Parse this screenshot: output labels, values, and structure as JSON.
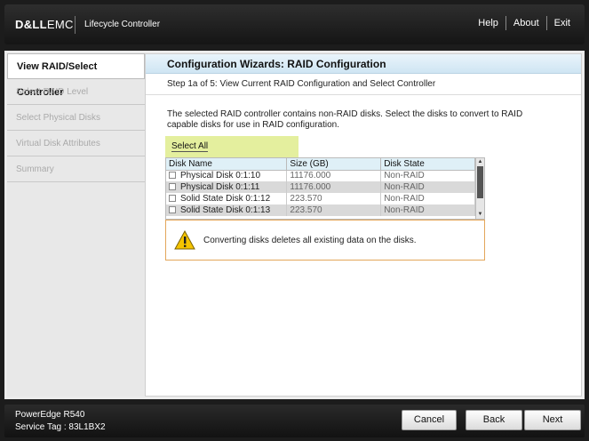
{
  "header": {
    "logo_dell": "D&LL",
    "logo_emc": "EMC",
    "product": "Lifecycle Controller",
    "nav": {
      "help": "Help",
      "about": "About",
      "exit": "Exit"
    }
  },
  "sidebar": {
    "steps": [
      {
        "label": "View RAID/Select Controller"
      },
      {
        "label": "Select RAID Level"
      },
      {
        "label": "Select Physical Disks"
      },
      {
        "label": "Virtual Disk Attributes"
      },
      {
        "label": "Summary"
      }
    ]
  },
  "main": {
    "title": "Configuration Wizards: RAID Configuration",
    "step_text": "Step 1a of 5: View Current RAID Configuration and Select Controller",
    "description": "The selected RAID controller contains non-RAID disks. Select the disks to convert to RAID capable disks for use in RAID configuration.",
    "select_all": "Select All",
    "table": {
      "headers": [
        "Disk Name",
        "Size (GB)",
        "Disk State"
      ],
      "rows": [
        {
          "name": "Physical Disk 0:1:10",
          "size": "11176.000",
          "state": "Non-RAID"
        },
        {
          "name": "Physical Disk 0:1:11",
          "size": "11176.000",
          "state": "Non-RAID"
        },
        {
          "name": "Solid State Disk 0:1:12",
          "size": "223.570",
          "state": "Non-RAID"
        },
        {
          "name": "Solid State Disk 0:1:13",
          "size": "223.570",
          "state": "Non-RAID"
        }
      ]
    },
    "warning": "Converting disks deletes all existing data on the disks.",
    "colors": {
      "warning_border": "#e3a65a",
      "select_all_bg": "#e4ef9e",
      "title_bg": "#cfe5f3"
    }
  },
  "footer": {
    "model": "PowerEdge R540",
    "service_tag": "Service Tag : 83L1BX2",
    "buttons": {
      "cancel": "Cancel",
      "back": "Back",
      "next": "Next"
    }
  }
}
